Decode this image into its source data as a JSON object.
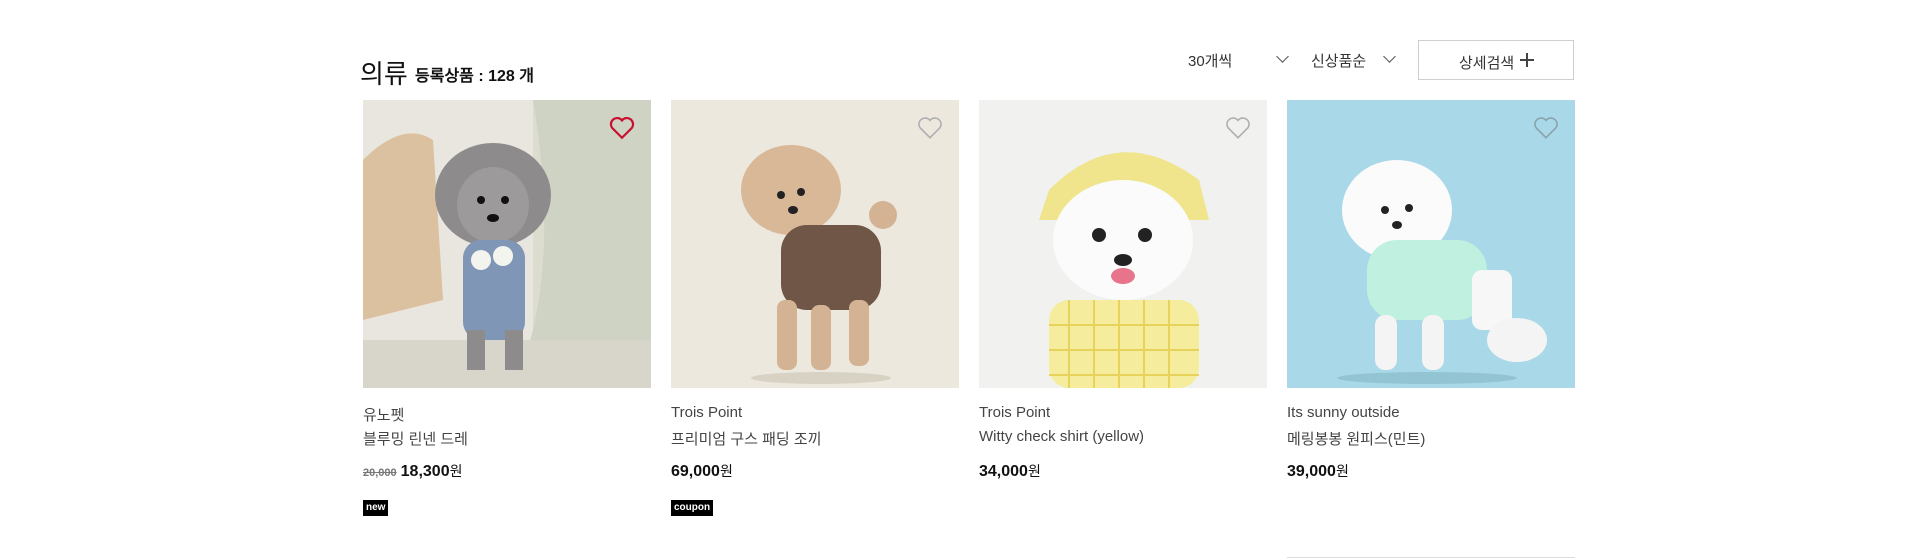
{
  "header": {
    "title": "의류",
    "count_label": "등록상품 : 128 개",
    "per_page": "30개씩",
    "sort": "신상품순",
    "advanced_search": "상세검색"
  },
  "colors": {
    "heart_active": "#c8102e",
    "heart_inactive": "#b0b0b0",
    "badge_bg": "#000000"
  },
  "products": [
    {
      "brand": "유노펫",
      "name": "블루밍 린넨 드레",
      "price_old": "20,000",
      "price": "18,300",
      "currency": "원",
      "badge": "new",
      "liked": true
    },
    {
      "brand": "Trois Point",
      "name": "프리미엄 구스 패딩 조끼",
      "price_old": "",
      "price": "69,000",
      "currency": "원",
      "badge": "coupon",
      "liked": false
    },
    {
      "brand": "Trois Point",
      "name": "Witty check shirt (yellow)",
      "price_old": "",
      "price": "34,000",
      "currency": "원",
      "badge": "",
      "liked": false
    },
    {
      "brand": "Its sunny outside",
      "name": "메링봉봉 원피스(민트)",
      "price_old": "",
      "price": "39,000",
      "currency": "원",
      "badge": "",
      "liked": false
    }
  ]
}
